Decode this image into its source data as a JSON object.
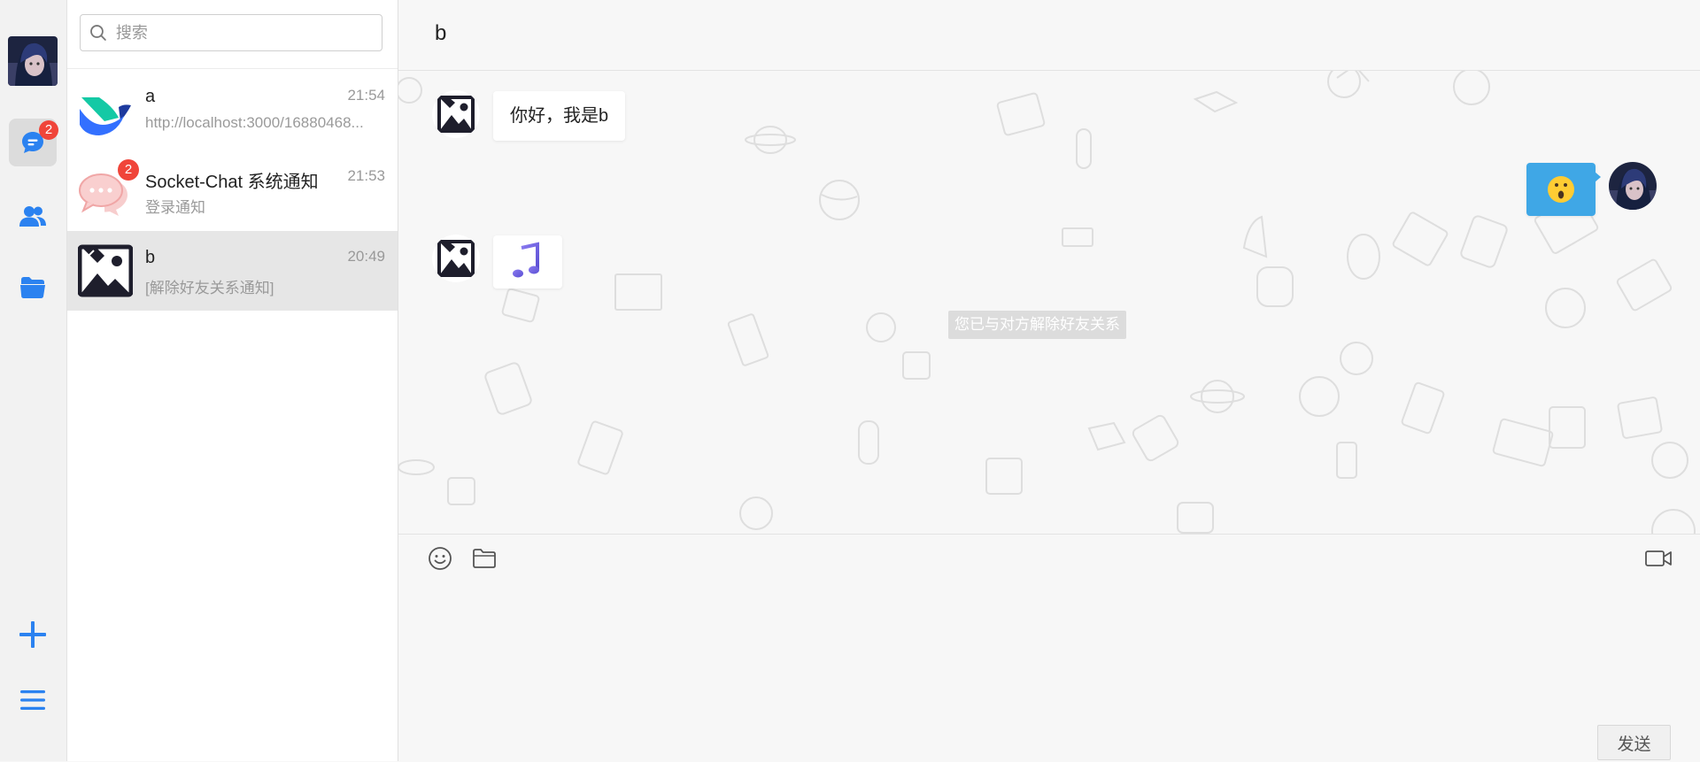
{
  "rail": {
    "chat_badge": "2",
    "accent": "#2b82f0"
  },
  "search": {
    "placeholder": "搜索"
  },
  "conversations": [
    {
      "name": "a",
      "time": "21:54",
      "preview": "http://localhost:3000/16880468...",
      "avatar": "feishu-logo"
    },
    {
      "name": "Socket-Chat 系统通知",
      "time": "21:53",
      "preview": "登录通知",
      "badge": "2",
      "avatar": "chat-bubbles-icon"
    },
    {
      "name": "b",
      "time": "20:49",
      "preview": "[解除好友关系通知]",
      "avatar": "broken-image-icon",
      "selected": true
    }
  ],
  "chat": {
    "title": "b",
    "messages": [
      {
        "from": "b",
        "text": "你好，我是b"
      },
      {
        "from": "me",
        "content": "emoji-surprised"
      },
      {
        "from": "b",
        "content": "music-note-icon"
      }
    ],
    "notice": "您已与对方解除好友关系",
    "send_label": "发送",
    "my_bubble_color": "#3fa7e6"
  }
}
